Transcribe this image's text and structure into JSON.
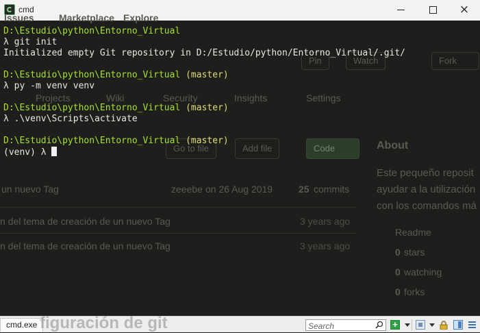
{
  "window": {
    "title": "cmd",
    "buttons": {
      "minimize": "minimize",
      "maximize": "maximize",
      "close": "×"
    }
  },
  "background_page": {
    "nav": [
      "Issues",
      "Marketplace",
      "Explore"
    ],
    "repo_actions": [
      "Pin",
      "Watch",
      "Fork"
    ],
    "repo_tabs": [
      "Projects",
      "Wiki",
      "Security",
      "Insights",
      "Settings"
    ],
    "file_buttons": {
      "goto": "Go to file",
      "add": "Add file",
      "code": "Code"
    },
    "commit_meta": {
      "author": "zeeebe",
      "date": "on 26 Aug 2019",
      "count": "25",
      "commits_label": "commits"
    },
    "commit_message_top": "un nuevo Tag",
    "files": [
      {
        "message": "n del tema de creación de un nuevo Tag",
        "age": "3 years ago"
      },
      {
        "message": "n del tema de creación de un nuevo Tag",
        "age": "3 years ago"
      }
    ],
    "about": {
      "title": "About",
      "description": [
        "Este pequeño reposit",
        "ayudar a la utilización",
        "con los comandos má"
      ],
      "stats": [
        {
          "icon": "book-icon",
          "value": "",
          "label": "Readme"
        },
        {
          "icon": "star-icon",
          "value": "0",
          "label": "stars"
        },
        {
          "icon": "eye-icon",
          "value": "0",
          "label": "watching"
        },
        {
          "icon": "fork-icon",
          "value": "0",
          "label": "forks"
        }
      ]
    },
    "heading_fragment": "figuración de git"
  },
  "terminal": {
    "lines": [
      {
        "type": "prompt",
        "path": "D:\\Estudio\\python\\Entorno_Virtual",
        "branch": ""
      },
      {
        "type": "command",
        "text": "λ git init"
      },
      {
        "type": "output",
        "text": "Initialized empty Git repository in D:/Estudio/python/Entorno_Virtual/.git/"
      },
      {
        "type": "prompt",
        "path": "D:\\Estudio\\python\\Entorno_Virtual",
        "branch": "(master)"
      },
      {
        "type": "command",
        "text": "λ py -m venv venv"
      },
      {
        "type": "prompt",
        "path": "D:\\Estudio\\python\\Entorno_Virtual",
        "branch": "(master)"
      },
      {
        "type": "command",
        "text": "λ .\\venv\\Scripts\\activate"
      },
      {
        "type": "prompt",
        "path": "D:\\Estudio\\python\\Entorno_Virtual",
        "branch": "(master)"
      },
      {
        "type": "current",
        "text": "(venv) λ "
      }
    ],
    "colors": {
      "path": "#a6e22e",
      "branch": "#e6db74",
      "text": "#e8e8e2",
      "background": "#1e1f1c"
    }
  },
  "statusbar": {
    "tab_label": "cmd.exe",
    "search_placeholder": "Search",
    "icons": [
      "search-icon",
      "add-console-icon",
      "dropdown-icon",
      "panel-icon",
      "lock-icon",
      "split-view-icon",
      "menu-icon"
    ]
  }
}
